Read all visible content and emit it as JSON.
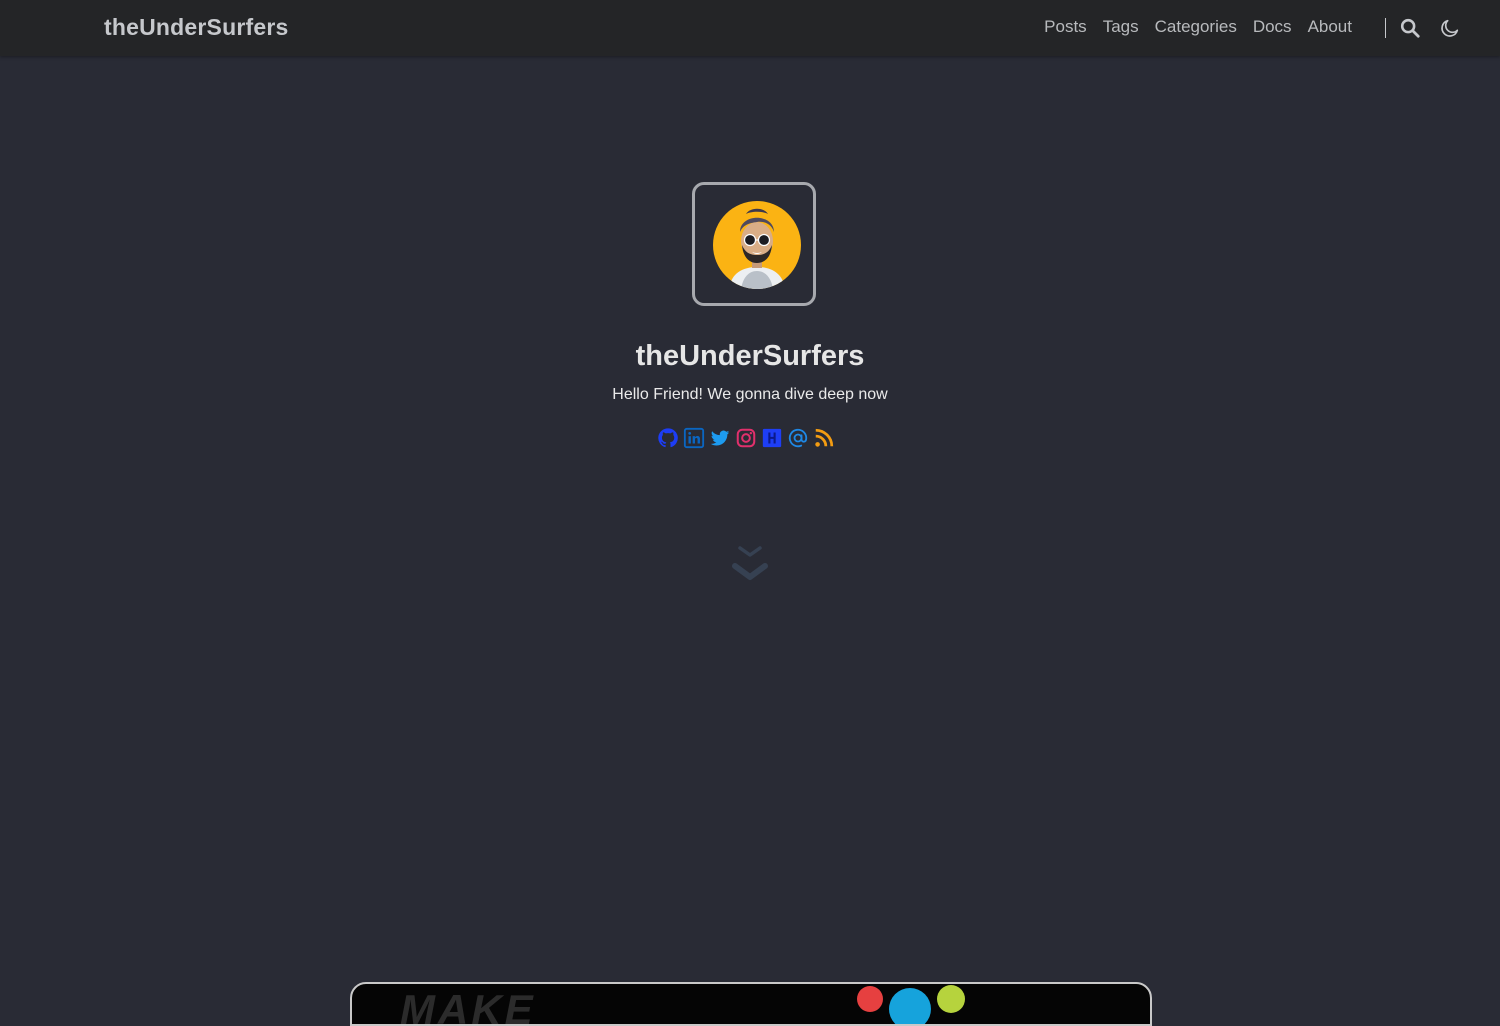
{
  "header": {
    "brand": "theUnderSurfers",
    "nav": [
      "Posts",
      "Tags",
      "Categories",
      "Docs",
      "About"
    ],
    "icons": [
      "search-icon",
      "moon-icon"
    ]
  },
  "profile": {
    "title": "theUnderSurfers",
    "subtitle": "Hello Friend! We gonna dive deep now",
    "avatar_bg": "#fbb313",
    "social": [
      {
        "name": "github-icon",
        "color": "#1d3df5"
      },
      {
        "name": "linkedin-icon",
        "color": "#0a66c2"
      },
      {
        "name": "twitter-icon",
        "color": "#1d9bf0"
      },
      {
        "name": "instagram-icon",
        "color": "#e1306c"
      },
      {
        "name": "hashnode-icon",
        "color": "#2f54ff"
      },
      {
        "name": "email-icon",
        "color": "#1e88e5"
      },
      {
        "name": "rss-icon",
        "color": "#f39c12"
      }
    ]
  },
  "featured_card": {
    "partial_text": "MAKE"
  },
  "colors": {
    "background": "#292b35",
    "header": "#242527",
    "text": "#e6e6e6"
  }
}
